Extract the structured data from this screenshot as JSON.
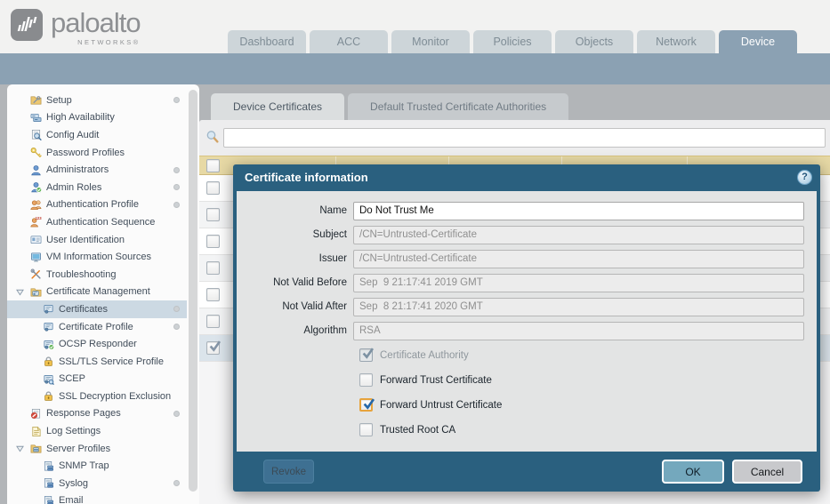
{
  "header": {
    "logo": {
      "brand": "paloalto",
      "sub": "NETWORKS®"
    },
    "nav_tabs": [
      {
        "label": "Dashboard",
        "active": false
      },
      {
        "label": "ACC",
        "active": false
      },
      {
        "label": "Monitor",
        "active": false
      },
      {
        "label": "Policies",
        "active": false
      },
      {
        "label": "Objects",
        "active": false
      },
      {
        "label": "Network",
        "active": false
      },
      {
        "label": "Device",
        "active": true
      }
    ]
  },
  "sidebar": {
    "items": [
      {
        "label": "Setup",
        "icon": "setup",
        "dot": true
      },
      {
        "label": "High Availability",
        "icon": "high-availability"
      },
      {
        "label": "Config Audit",
        "icon": "config-audit"
      },
      {
        "label": "Password Profiles",
        "icon": "key"
      },
      {
        "label": "Administrators",
        "icon": "user",
        "dot": true
      },
      {
        "label": "Admin Roles",
        "icon": "user-check",
        "dot": true
      },
      {
        "label": "Authentication Profile",
        "icon": "users",
        "dot": true
      },
      {
        "label": "Authentication Sequence",
        "icon": "users-seq"
      },
      {
        "label": "User Identification",
        "icon": "id-card"
      },
      {
        "label": "VM Information Sources",
        "icon": "monitor"
      },
      {
        "label": "Troubleshooting",
        "icon": "tools"
      },
      {
        "label": "Certificate Management",
        "icon": "folder-cert",
        "expanded": true
      },
      {
        "label": "Certificates",
        "icon": "certificate",
        "indent": 1,
        "selected": true,
        "dot": true
      },
      {
        "label": "Certificate Profile",
        "icon": "certificate",
        "indent": 1,
        "dot": true
      },
      {
        "label": "OCSP Responder",
        "icon": "cert-check",
        "indent": 1
      },
      {
        "label": "SSL/TLS Service Profile",
        "icon": "lock",
        "indent": 1
      },
      {
        "label": "SCEP",
        "icon": "cert-search",
        "indent": 1
      },
      {
        "label": "SSL Decryption Exclusion",
        "icon": "lock",
        "indent": 1
      },
      {
        "label": "Response Pages",
        "icon": "blocked",
        "dot": true
      },
      {
        "label": "Log Settings",
        "icon": "doc"
      },
      {
        "label": "Server Profiles",
        "icon": "folder-server",
        "expanded": true
      },
      {
        "label": "SNMP Trap",
        "icon": "server-doc",
        "indent": 1
      },
      {
        "label": "Syslog",
        "icon": "server-doc",
        "indent": 1,
        "dot": true
      },
      {
        "label": "Email",
        "icon": "server-doc",
        "indent": 1
      }
    ]
  },
  "content": {
    "tabs": [
      {
        "label": "Device Certificates",
        "active": true
      },
      {
        "label": "Default Trusted Certificate Authorities",
        "active": false
      }
    ],
    "search": {
      "value": ""
    },
    "table": {
      "rows": [
        {
          "checked": false
        },
        {
          "checked": false
        },
        {
          "checked": false
        },
        {
          "checked": false
        },
        {
          "checked": false
        },
        {
          "checked": false
        },
        {
          "checked": true,
          "selected": true
        }
      ]
    }
  },
  "dialog": {
    "title": "Certificate information",
    "help_glyph": "?",
    "fields": [
      {
        "label": "Name",
        "value": "Do Not Trust Me",
        "disabled": false
      },
      {
        "label": "Subject",
        "value": "/CN=Untrusted-Certificate",
        "disabled": true
      },
      {
        "label": "Issuer",
        "value": "/CN=Untrusted-Certificate",
        "disabled": true
      },
      {
        "label": "Not Valid Before",
        "value": "Sep  9 21:17:41 2019 GMT",
        "disabled": true
      },
      {
        "label": "Not Valid After",
        "value": "Sep  8 21:17:41 2020 GMT",
        "disabled": true
      },
      {
        "label": "Algorithm",
        "value": "RSA",
        "disabled": true
      }
    ],
    "checkboxes": [
      {
        "label": "Certificate Authority",
        "checked": true,
        "disabled": true
      },
      {
        "label": "Forward Trust Certificate",
        "checked": false
      },
      {
        "label": "Forward Untrust Certificate",
        "checked": true,
        "focused": true
      },
      {
        "label": "Trusted Root CA",
        "checked": false
      }
    ],
    "buttons": {
      "revoke": "Revoke",
      "ok": "OK",
      "cancel": "Cancel"
    }
  },
  "colors": {
    "titlebar_teal": "#2a607f",
    "band_blue": "#8ba1b3",
    "table_header_yellow": "#e7d9a5",
    "ok_button": "#74a8bd",
    "focus_orange": "#e7a33c",
    "selected_row_blue": "#ccd9e3"
  }
}
